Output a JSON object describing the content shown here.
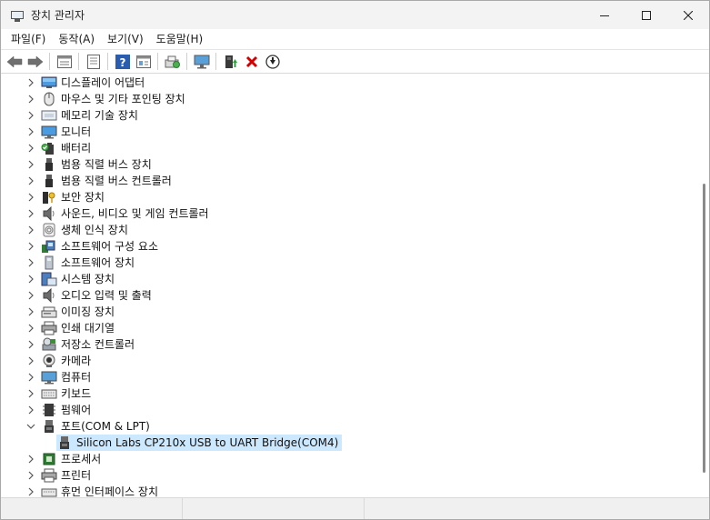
{
  "window": {
    "title": "장치 관리자",
    "controls": [
      "minimize-icon",
      "maximize-icon",
      "close-icon"
    ]
  },
  "menu": [
    {
      "label": "파일(F)"
    },
    {
      "label": "동작(A)"
    },
    {
      "label": "보기(V)"
    },
    {
      "label": "도움말(H)"
    }
  ],
  "toolbar": [
    "back-arrow-icon",
    "forward-arrow-icon",
    "properties-icon",
    "sheet-icon",
    "help-icon",
    "view-icon",
    "scan-hardware-icon",
    "monitor-icon",
    "update-driver-icon",
    "uninstall-x-icon",
    "disable-icon"
  ],
  "tree": {
    "items": [
      {
        "label": "디스플레이 어댑터",
        "icon": "display-adapter-icon",
        "expanded": false
      },
      {
        "label": "마우스 및 기타 포인팅 장치",
        "icon": "mouse-icon",
        "expanded": false
      },
      {
        "label": "메모리 기술 장치",
        "icon": "memory-icon",
        "expanded": false
      },
      {
        "label": "모니터",
        "icon": "monitor-icon",
        "expanded": false
      },
      {
        "label": "배터리",
        "icon": "battery-icon",
        "expanded": false
      },
      {
        "label": "범용 직렬 버스 장치",
        "icon": "usb-icon",
        "expanded": false
      },
      {
        "label": "범용 직렬 버스 컨트롤러",
        "icon": "usb-icon",
        "expanded": false
      },
      {
        "label": "보안 장치",
        "icon": "security-key-icon",
        "expanded": false
      },
      {
        "label": "사운드, 비디오 및 게임 컨트롤러",
        "icon": "speaker-icon",
        "expanded": false
      },
      {
        "label": "생체 인식 장치",
        "icon": "fingerprint-icon",
        "expanded": false
      },
      {
        "label": "소프트웨어 구성 요소",
        "icon": "software-component-icon",
        "expanded": false
      },
      {
        "label": "소프트웨어 장치",
        "icon": "software-device-icon",
        "expanded": false
      },
      {
        "label": "시스템 장치",
        "icon": "system-device-icon",
        "expanded": false
      },
      {
        "label": "오디오 입력 및 출력",
        "icon": "speaker-icon",
        "expanded": false
      },
      {
        "label": "이미징 장치",
        "icon": "scanner-icon",
        "expanded": false
      },
      {
        "label": "인쇄 대기열",
        "icon": "printer-icon",
        "expanded": false
      },
      {
        "label": "저장소 컨트롤러",
        "icon": "storage-controller-icon",
        "expanded": false
      },
      {
        "label": "카메라",
        "icon": "camera-icon",
        "expanded": false
      },
      {
        "label": "컴퓨터",
        "icon": "computer-icon",
        "expanded": false
      },
      {
        "label": "키보드",
        "icon": "keyboard-icon",
        "expanded": false
      },
      {
        "label": "펌웨어",
        "icon": "firmware-icon",
        "expanded": false
      },
      {
        "label": "포트(COM & LPT)",
        "icon": "port-icon",
        "expanded": true,
        "children": [
          {
            "label": "Silicon Labs CP210x USB to UART Bridge(COM4)",
            "icon": "port-icon",
            "selected": true
          }
        ]
      },
      {
        "label": "프로세서",
        "icon": "processor-icon",
        "expanded": false
      },
      {
        "label": "프린터",
        "icon": "printer-icon",
        "expanded": false
      },
      {
        "label": "휴먼 인터페이스 장치",
        "icon": "hid-icon",
        "expanded": false
      }
    ]
  },
  "colors": {
    "selection": "#cce8ff",
    "uninstall_red": "#d40000",
    "help_blue": "#2a5db0"
  }
}
